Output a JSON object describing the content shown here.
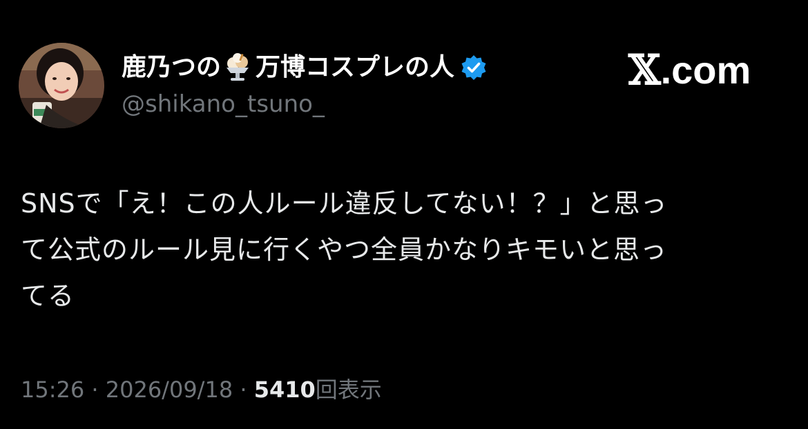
{
  "author": {
    "display_name_part1": "鹿乃つの",
    "display_name_part2": "万博コスプレの人",
    "emoji_icon": "ice-cream-sundae-icon",
    "verified_icon": "verified-badge-icon",
    "handle": "@shikano_tsuno_",
    "avatar_icon": "profile-photo"
  },
  "brand": {
    "logo": "𝕏",
    "domain": ".com"
  },
  "tweet": {
    "lines": [
      "SNSで「え！この人ルール違反してない！？」と思っ",
      "て公式のルール見に行くやつ全員かなりキモいと思っ",
      "てる"
    ]
  },
  "meta": {
    "time": "15:26",
    "separator1": " · ",
    "date": "2026/09/18",
    "separator2": " · ",
    "views_count": "5410",
    "views_label": "回表示"
  },
  "colors": {
    "background": "#000000",
    "text_primary": "#e7e9ea",
    "text_secondary": "#71767b",
    "verified_blue": "#1d9bf0"
  }
}
